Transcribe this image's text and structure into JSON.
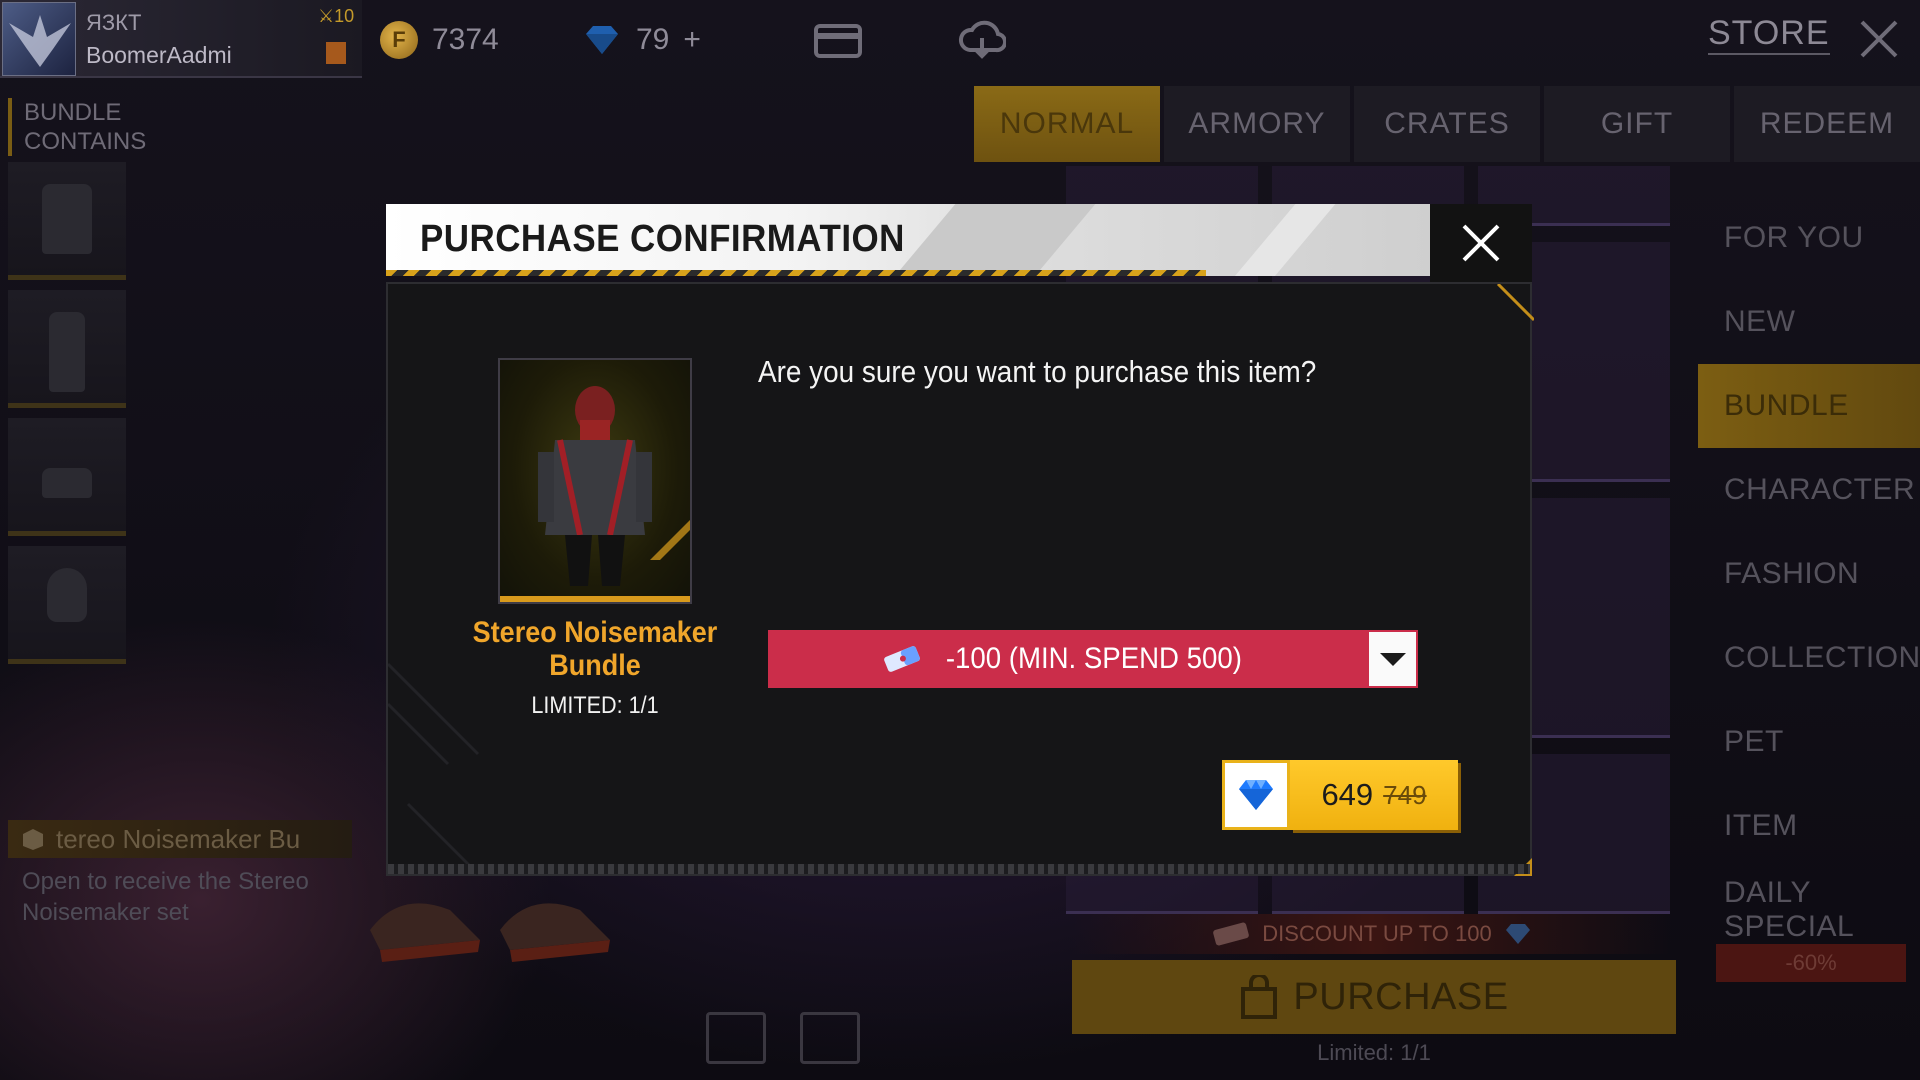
{
  "player": {
    "guild": "ЯЗКТ",
    "name": "BoomerAadmi",
    "level": "10"
  },
  "currency": {
    "gold": "7374",
    "diamonds": "79",
    "diamonds_plus": "+"
  },
  "store": {
    "title": "STORE"
  },
  "tabs": [
    {
      "label": "NORMAL",
      "active": true
    },
    {
      "label": "ARMORY",
      "active": false
    },
    {
      "label": "CRATES",
      "active": false
    },
    {
      "label": "GIFT",
      "active": false
    },
    {
      "label": "REDEEM",
      "active": false
    }
  ],
  "side_menu": [
    {
      "label": "FOR YOU",
      "active": false
    },
    {
      "label": "NEW",
      "active": false
    },
    {
      "label": "BUNDLE",
      "active": true
    },
    {
      "label": "CHARACTER",
      "active": false
    },
    {
      "label": "FASHION",
      "active": false
    },
    {
      "label": "COLLECTION",
      "active": false
    },
    {
      "label": "PET",
      "active": false
    },
    {
      "label": "ITEM",
      "active": false
    },
    {
      "label": "DAILY SPECIAL",
      "active": false
    }
  ],
  "side_badge": "-60%",
  "bundle_panel": {
    "heading_line1": "BUNDLE",
    "heading_line2": "CONTAINS",
    "name": "tereo Noisemaker Bu",
    "description": "Open to receive the Stereo Noisemaker set"
  },
  "background": {
    "discount_text": "DISCOUNT UP TO 100",
    "purchase_label": "PURCHASE",
    "limited_text": "Limited: 1/1"
  },
  "modal": {
    "title": "PURCHASE CONFIRMATION",
    "question": "Are you sure you want to purchase this item?",
    "item_name_line1": "Stereo Noisemaker",
    "item_name_line2": "Bundle",
    "item_limit": "LIMITED: 1/1",
    "voucher_label": "-100 (MIN. SPEND 500)",
    "price_current": "649",
    "price_original": "749"
  },
  "colors": {
    "accent_gold": "#f0b10f",
    "voucher_red": "#cb2d4a",
    "item_name_orange": "#f0a62b",
    "diamond_blue": "#1e7bff"
  }
}
